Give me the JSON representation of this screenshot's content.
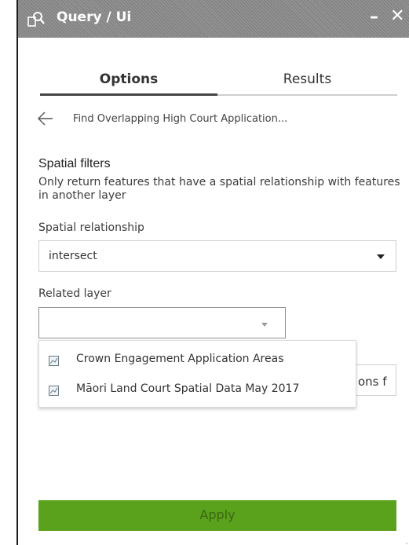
{
  "window": {
    "title": "Query / Ui",
    "minimize_label": "–",
    "close_label": "✕"
  },
  "tabs": [
    {
      "label": "Options"
    },
    {
      "label": "Results"
    }
  ],
  "back_nav": {
    "label": "Find Overlapping High Court Application..."
  },
  "spatial_filters": {
    "title": "Spatial filters",
    "description": "Only return features that have a spatial relationship with features in another layer",
    "relationship_label": "Spatial relationship",
    "relationship_value": "intersect",
    "related_layer_label": "Related layer",
    "related_layer_value": "",
    "layer_options": [
      {
        "label": "Crown Engagement Application Areas",
        "icon": "layer-icon"
      },
      {
        "label": "Māori Land Court Spatial Data May 2017",
        "icon": "layer-icon"
      }
    ],
    "hidden_field_partial_text": "ons f"
  },
  "apply_button": {
    "label": "Apply",
    "color": "#5aa21c"
  },
  "colors": {
    "titlebar": "#8a8a8a",
    "accent": "#5aa21c"
  }
}
